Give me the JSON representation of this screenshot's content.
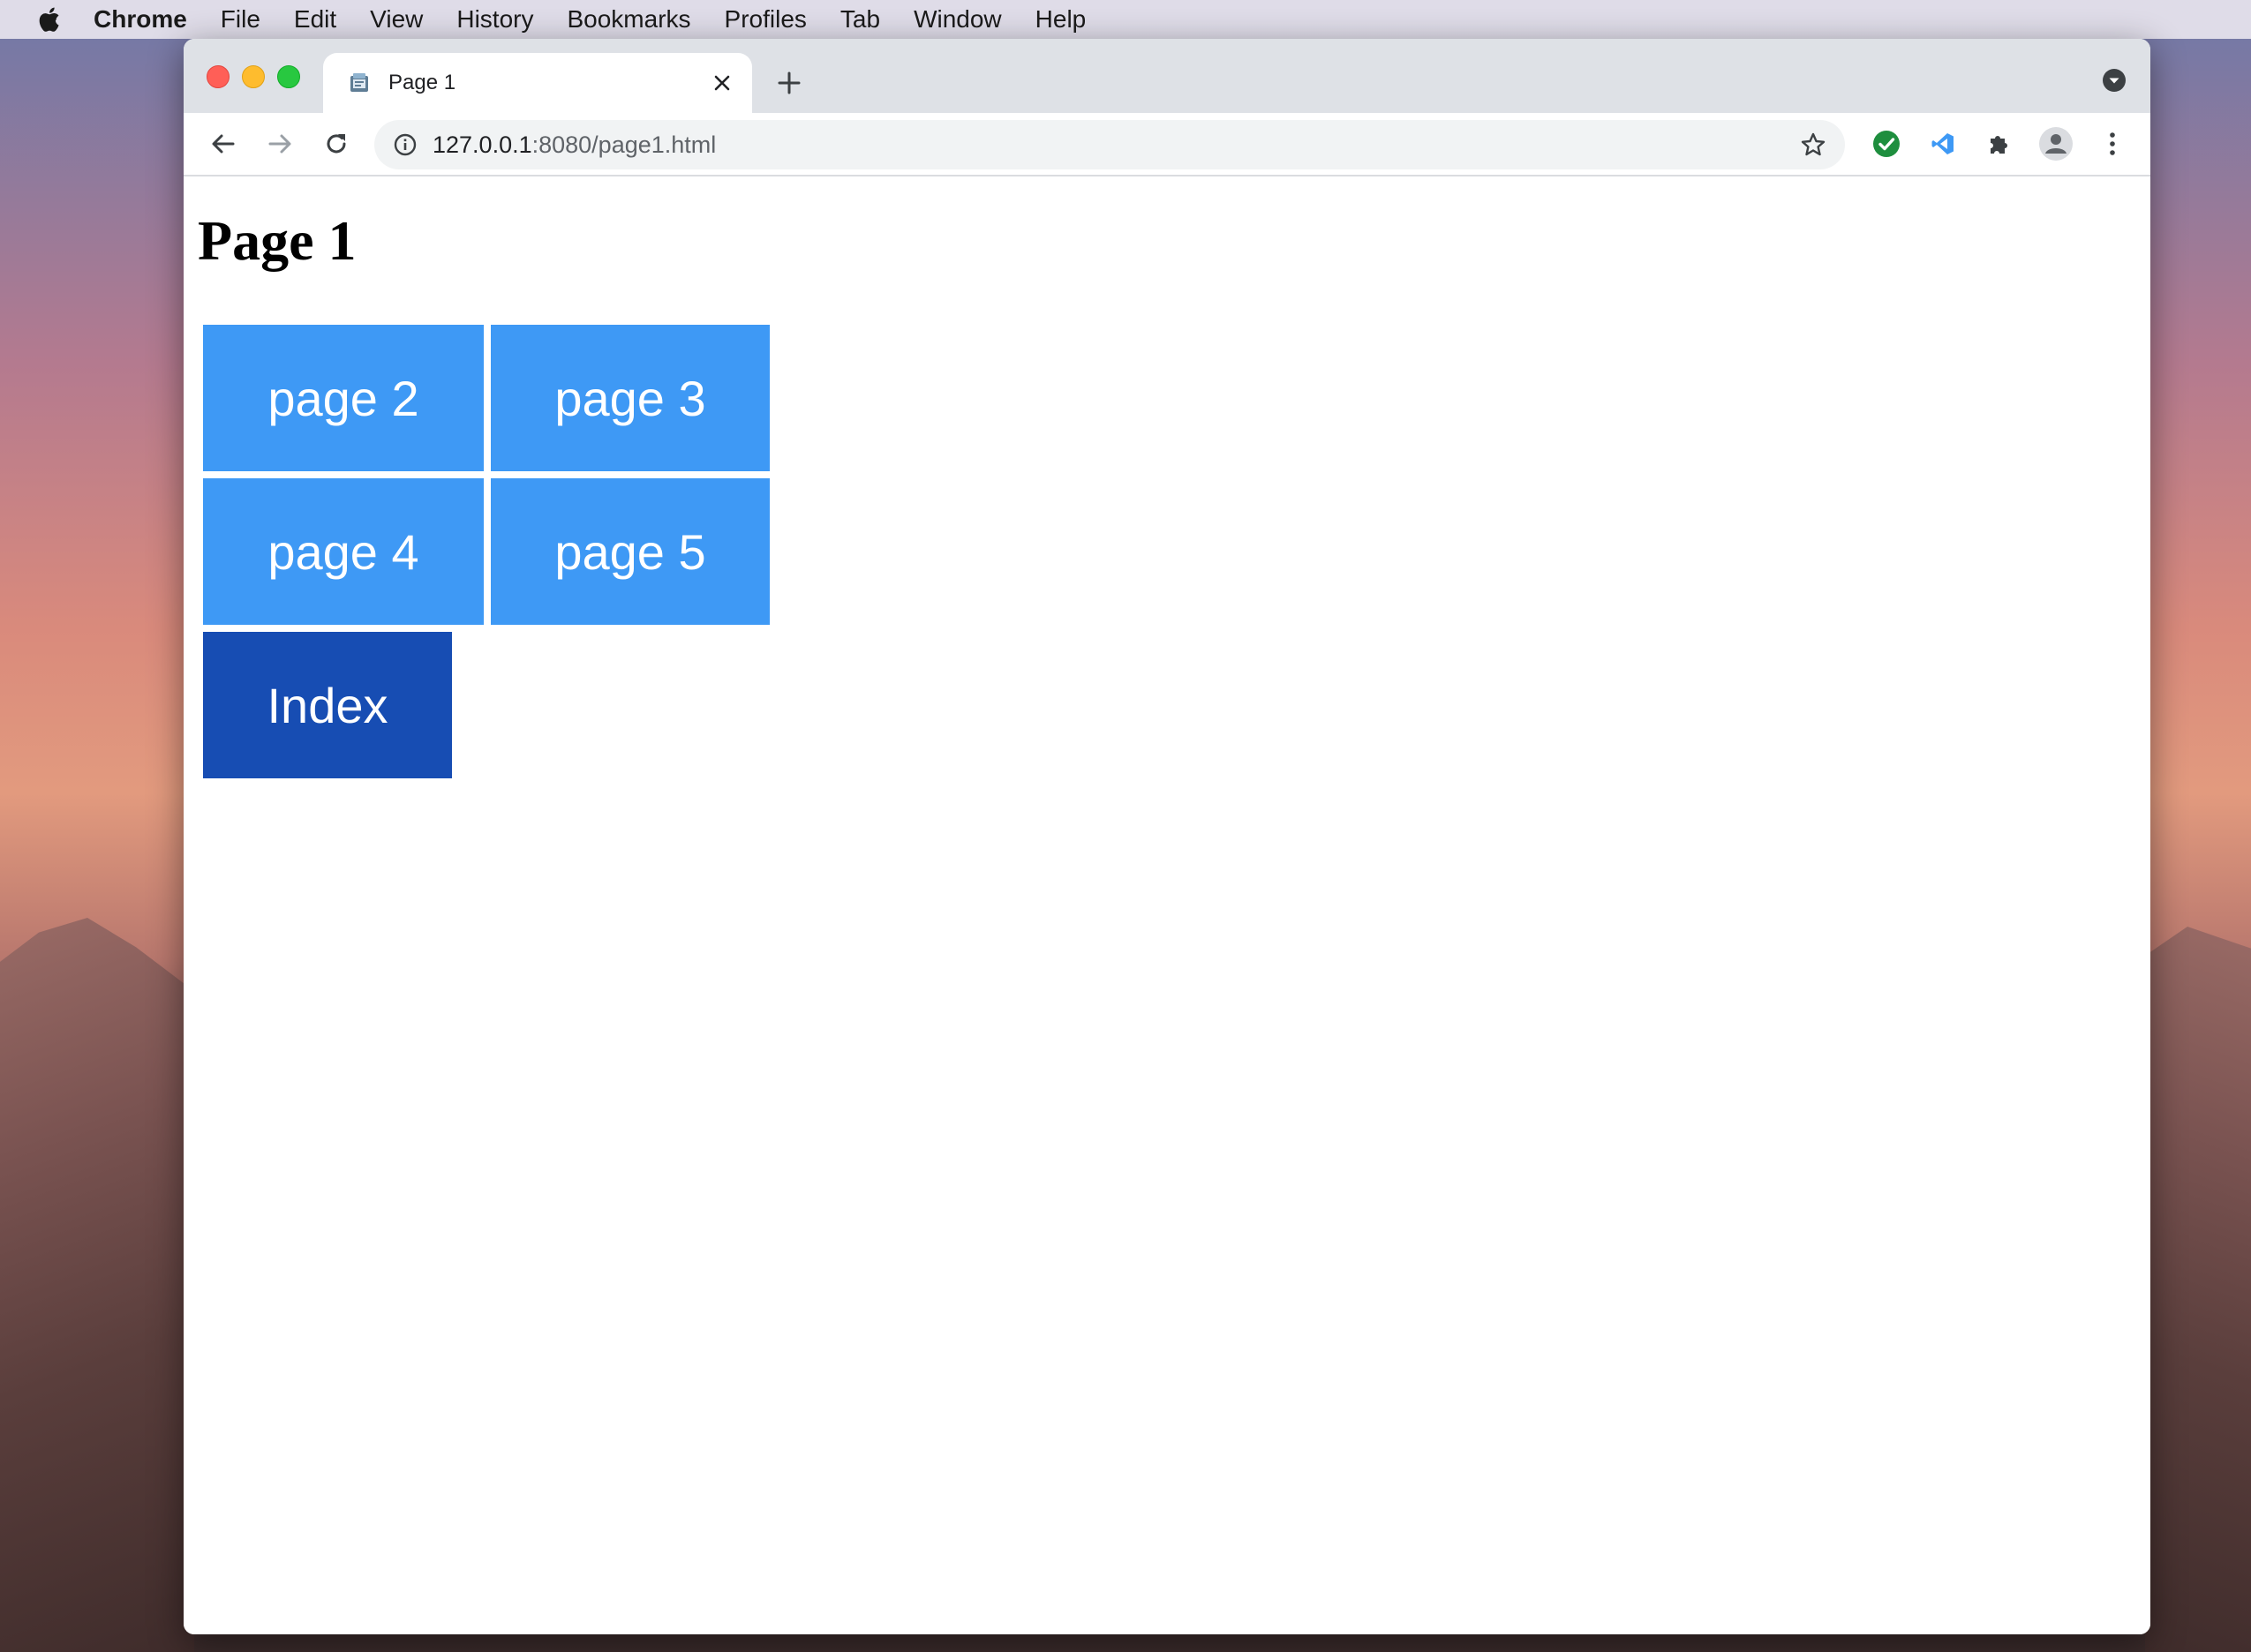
{
  "menubar": {
    "app_name": "Chrome",
    "items": [
      "File",
      "Edit",
      "View",
      "History",
      "Bookmarks",
      "Profiles",
      "Tab",
      "Window",
      "Help"
    ]
  },
  "browser": {
    "tab": {
      "title": "Page 1",
      "favicon": "page-favicon-icon"
    },
    "address_bar": {
      "host": "127.0.0.1",
      "path": ":8080/page1.html"
    },
    "toolbar_icons": [
      "back-arrow-icon",
      "forward-arrow-icon",
      "reload-icon",
      "info-icon",
      "bookmark-star-icon",
      "check-extension-icon",
      "vscode-extension-icon",
      "puzzle-extensions-icon",
      "profile-avatar-icon",
      "kebab-menu-icon"
    ]
  },
  "page": {
    "heading": "Page 1",
    "buttons": {
      "page2": "page 2",
      "page3": "page 3",
      "page4": "page 4",
      "page5": "page 5",
      "index": "Index"
    }
  },
  "colors": {
    "button_light": "#3e99f5",
    "button_dark": "#174db3",
    "extension_check": "#1e8e3e"
  }
}
